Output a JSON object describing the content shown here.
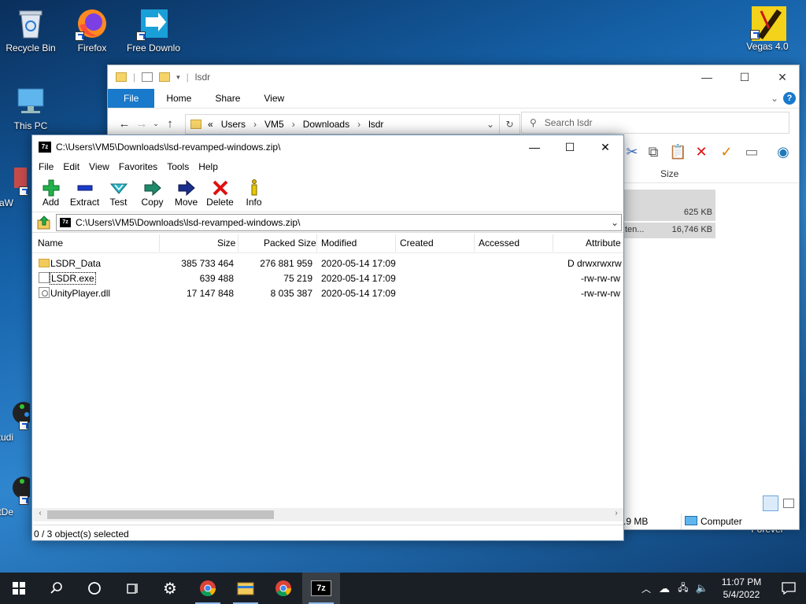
{
  "desktop": {
    "icons": [
      {
        "label": "Recycle Bin",
        "icon": "recycle-bin-icon"
      },
      {
        "label": "Firefox",
        "icon": "firefox-icon"
      },
      {
        "label": "Free Downlo",
        "icon": "free-download-manager-icon"
      },
      {
        "label": "Vegas 4.0",
        "icon": "vegas-icon"
      },
      {
        "label": "This PC",
        "icon": "computer-icon"
      },
      {
        "label": "DataW",
        "icon": "app-icon"
      },
      {
        "label": "Studi",
        "icon": "app-icon"
      },
      {
        "label": "PartDe",
        "icon": "app-icon"
      },
      {
        "label": "Forever",
        "icon": "app-icon"
      }
    ]
  },
  "explorer": {
    "title": "lsdr",
    "ribbon_tabs": [
      "File",
      "Home",
      "Share",
      "View"
    ],
    "breadcrumb_prefix": "«",
    "breadcrumb": [
      "Users",
      "VM5",
      "Downloads",
      "lsdr"
    ],
    "search_placeholder": "Search lsdr",
    "column_size": "Size",
    "rows": [
      {
        "name": "",
        "size": "625 KB"
      },
      {
        "name": "ten...",
        "size": "16,746 KB"
      }
    ],
    "status_size": ".9 MB",
    "status_location": "Computer"
  },
  "zip": {
    "title": "C:\\Users\\VM5\\Downloads\\lsd-revamped-windows.zip\\",
    "menu": [
      "File",
      "Edit",
      "View",
      "Favorites",
      "Tools",
      "Help"
    ],
    "toolbar": [
      {
        "label": "Add",
        "icon": "add-plus-icon",
        "color": "#22b14c"
      },
      {
        "label": "Extract",
        "icon": "extract-minus-icon",
        "color": "#1a3cc8"
      },
      {
        "label": "Test",
        "icon": "test-check-icon",
        "color": "#2ab7c9"
      },
      {
        "label": "Copy",
        "icon": "copy-arrow-icon",
        "color": "#1f8a6b"
      },
      {
        "label": "Move",
        "icon": "move-arrow-icon",
        "color": "#1c2f8c"
      },
      {
        "label": "Delete",
        "icon": "delete-x-icon",
        "color": "#e01010"
      },
      {
        "label": "Info",
        "icon": "info-icon",
        "color": "#c8a400"
      }
    ],
    "path": "C:\\Users\\VM5\\Downloads\\lsd-revamped-windows.zip\\",
    "columns": [
      "Name",
      "Size",
      "Packed Size",
      "Modified",
      "Created",
      "Accessed",
      "Attribute"
    ],
    "files": [
      {
        "name": "LSDR_Data",
        "type": "folder",
        "size": "385 733 464",
        "packed": "276 881 959",
        "modified": "2020-05-14 17:09",
        "created": "",
        "accessed": "",
        "attr": "D drwxrwxrw"
      },
      {
        "name": "LSDR.exe",
        "type": "exe",
        "size": "639 488",
        "packed": "75 219",
        "modified": "2020-05-14 17:09",
        "created": "",
        "accessed": "",
        "attr": "-rw-rw-rw"
      },
      {
        "name": "UnityPlayer.dll",
        "type": "dll",
        "size": "17 147 848",
        "packed": "8 035 387",
        "modified": "2020-05-14 17:09",
        "created": "",
        "accessed": "",
        "attr": "-rw-rw-rw"
      }
    ],
    "status": "0 / 3 object(s) selected"
  },
  "taskbar": {
    "time": "11:07 PM",
    "date": "5/4/2022",
    "pinned": [
      "start",
      "search",
      "cortana",
      "task-view",
      "settings",
      "chrome",
      "file-explorer",
      "chrome",
      "7zip"
    ],
    "active_app": "7zip"
  }
}
